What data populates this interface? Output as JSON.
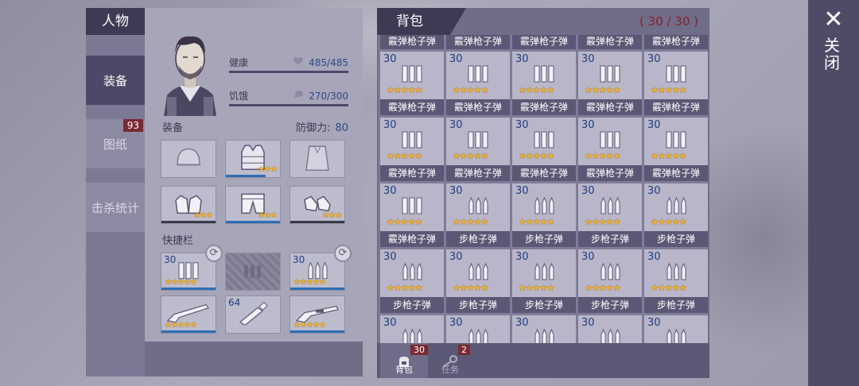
{
  "character_panel": {
    "title": "人物",
    "tabs": [
      {
        "label": "装备",
        "active": true
      },
      {
        "label": "图纸",
        "badge": "93"
      },
      {
        "label": "击杀统计"
      }
    ],
    "stats": {
      "health_label": "健康",
      "health_value": "485/485",
      "hunger_label": "饥饿",
      "hunger_value": "270/300"
    },
    "equipment_title": "装备",
    "defense_label": "防御力:",
    "defense_value": "80",
    "equipment_slots": [
      {
        "name": "helmet",
        "stars": 0,
        "icon": "helmet-icon"
      },
      {
        "name": "body-armor",
        "stars": 3,
        "icon": "vest-icon"
      },
      {
        "name": "cloak",
        "stars": 0,
        "icon": "cloak-icon"
      },
      {
        "name": "gloves",
        "stars": 3,
        "icon": "gloves-icon"
      },
      {
        "name": "pants",
        "stars": 3,
        "icon": "pants-icon"
      },
      {
        "name": "shoes",
        "stars": 3,
        "icon": "shoes-icon"
      }
    ],
    "quickbar_title": "快捷栏",
    "quickbar_slots": [
      {
        "count": "30",
        "stars": 5,
        "icon": "shotgun-shells-icon",
        "refresh": true
      },
      {
        "count": "",
        "stars": 0,
        "icon": "locked-slot-icon",
        "locked": true
      },
      {
        "count": "30",
        "stars": 5,
        "icon": "rifle-ammo-icon",
        "refresh": true
      },
      {
        "count": "",
        "stars": 5,
        "icon": "shotgun-icon"
      },
      {
        "count": "64",
        "stars": 0,
        "icon": "water-bottle-icon"
      },
      {
        "count": "",
        "stars": 5,
        "icon": "rifle-icon"
      }
    ]
  },
  "backpack": {
    "title": "背包",
    "capacity": "( 30 / 30 )",
    "top_partial_row": [
      "霰弹枪子弹",
      "霰弹枪子弹",
      "霰弹枪子弹",
      "霰弹枪子弹",
      "霰弹枪子弹"
    ],
    "items": [
      {
        "count": "30",
        "name": "霰弹枪子弹",
        "icon": "shotgun-shells-icon"
      },
      {
        "count": "30",
        "name": "霰弹枪子弹",
        "icon": "shotgun-shells-icon"
      },
      {
        "count": "30",
        "name": "霰弹枪子弹",
        "icon": "shotgun-shells-icon"
      },
      {
        "count": "30",
        "name": "霰弹枪子弹",
        "icon": "shotgun-shells-icon"
      },
      {
        "count": "30",
        "name": "霰弹枪子弹",
        "icon": "shotgun-shells-icon"
      },
      {
        "count": "30",
        "name": "霰弹枪子弹",
        "icon": "shotgun-shells-icon"
      },
      {
        "count": "30",
        "name": "霰弹枪子弹",
        "icon": "shotgun-shells-icon"
      },
      {
        "count": "30",
        "name": "霰弹枪子弹",
        "icon": "shotgun-shells-icon"
      },
      {
        "count": "30",
        "name": "霰弹枪子弹",
        "icon": "shotgun-shells-icon"
      },
      {
        "count": "30",
        "name": "霰弹枪子弹",
        "icon": "shotgun-shells-icon"
      },
      {
        "count": "30",
        "name": "霰弹枪子弹",
        "icon": "shotgun-shells-icon"
      },
      {
        "count": "30",
        "name": "步枪子弹",
        "icon": "rifle-ammo-icon"
      },
      {
        "count": "30",
        "name": "步枪子弹",
        "icon": "rifle-ammo-icon"
      },
      {
        "count": "30",
        "name": "步枪子弹",
        "icon": "rifle-ammo-icon"
      },
      {
        "count": "30",
        "name": "步枪子弹",
        "icon": "rifle-ammo-icon"
      },
      {
        "count": "30",
        "name": "步枪子弹",
        "icon": "rifle-ammo-icon"
      },
      {
        "count": "30",
        "name": "步枪子弹",
        "icon": "rifle-ammo-icon"
      },
      {
        "count": "30",
        "name": "步枪子弹",
        "icon": "rifle-ammo-icon"
      },
      {
        "count": "30",
        "name": "步枪子弹",
        "icon": "rifle-ammo-icon"
      },
      {
        "count": "30",
        "name": "步枪子弹",
        "icon": "rifle-ammo-icon"
      }
    ],
    "bottom_partial_counts": [
      "30",
      "30",
      "30",
      "30",
      "30"
    ],
    "item_stars": 5,
    "footer_tabs": [
      {
        "label": "背包",
        "badge": "30",
        "icon": "backpack-icon",
        "active": true
      },
      {
        "label": "任务",
        "badge": "2",
        "icon": "key-icon"
      }
    ]
  },
  "close": {
    "label": "关闭",
    "icon": "close-icon"
  },
  "colors": {
    "panel": "#7b7994",
    "header": "#3d3b54",
    "star": "#f5b11e",
    "count": "#1f3d82",
    "badge": "#7a2a33"
  }
}
